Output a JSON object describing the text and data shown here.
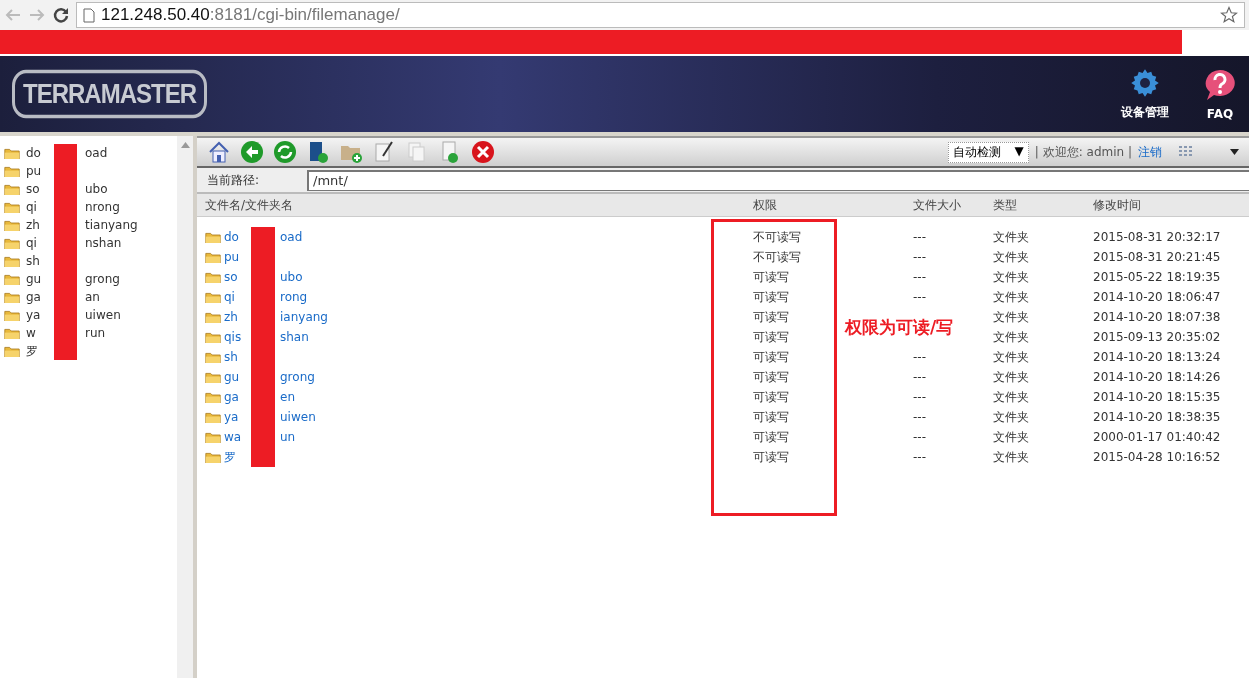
{
  "browser": {
    "url_host": "121.248.50.40",
    "url_path": ":8181/cgi-bin/filemanage/"
  },
  "header": {
    "logo_text": "TERRAMASTER",
    "nav": [
      {
        "kind": "gear",
        "label": "设备管理"
      },
      {
        "kind": "faq",
        "label": "FAQ"
      }
    ]
  },
  "tree": {
    "items": [
      {
        "start": "do",
        "end": "oad"
      },
      {
        "start": "pu"
      },
      {
        "start": "so",
        "end": "ubo"
      },
      {
        "start": "qi",
        "end": "nrong"
      },
      {
        "start": "zh",
        "end": "tianyang"
      },
      {
        "start": "qi",
        "end": "nshan"
      },
      {
        "start": "sh"
      },
      {
        "start": "gu",
        "end": "grong"
      },
      {
        "start": "ga",
        "end": "an"
      },
      {
        "start": "ya",
        "end": "uiwen"
      },
      {
        "start": "w",
        "end": "run"
      },
      {
        "start": "罗"
      }
    ]
  },
  "toolbar": {
    "encoding": "自动检测",
    "encoding_caret": "▼",
    "welcome": "| 欢迎您: admin |",
    "logout": "注销"
  },
  "path": {
    "label": "当前路径:",
    "value": "/mnt/"
  },
  "table": {
    "columns": [
      "文件名/文件夹名",
      "权限",
      "文件大小",
      "类型",
      "修改时间"
    ],
    "rows": [
      {
        "start": "do",
        "end": "oad",
        "permission": "不可读写",
        "size": "---",
        "type": "文件夹",
        "modified": "2015-08-31 20:32:17"
      },
      {
        "start": "pu",
        "permission": "不可读写",
        "size": "---",
        "type": "文件夹",
        "modified": "2015-08-31 20:21:45"
      },
      {
        "start": "so",
        "end": "ubo",
        "permission": "可读写",
        "size": "---",
        "type": "文件夹",
        "modified": "2015-05-22 18:19:35"
      },
      {
        "start": "qi",
        "end": "rong",
        "permission": "可读写",
        "size": "---",
        "type": "文件夹",
        "modified": "2014-10-20 18:06:47"
      },
      {
        "start": "zh",
        "end": "ianyang",
        "permission": "可读写",
        "type": "文件夹",
        "modified": "2014-10-20 18:07:38"
      },
      {
        "start": "qis",
        "end": "shan",
        "permission": "可读写",
        "type": "文件夹",
        "modified": "2015-09-13 20:35:02"
      },
      {
        "start": "sh",
        "permission": "可读写",
        "size": "---",
        "type": "文件夹",
        "modified": "2014-10-20 18:13:24"
      },
      {
        "start": "gu",
        "end": "grong",
        "permission": "可读写",
        "size": "---",
        "type": "文件夹",
        "modified": "2014-10-20 18:14:26"
      },
      {
        "start": "ga",
        "end": "en",
        "permission": "可读写",
        "size": "---",
        "type": "文件夹",
        "modified": "2014-10-20 18:15:35"
      },
      {
        "start": "ya",
        "end": "uiwen",
        "permission": "可读写",
        "size": "---",
        "type": "文件夹",
        "modified": "2014-10-20 18:38:35"
      },
      {
        "start": "wa",
        "end": "un",
        "permission": "可读写",
        "size": "---",
        "type": "文件夹",
        "modified": "2000-01-17 01:40:42"
      },
      {
        "start": "罗",
        "permission": "可读写",
        "size": "---",
        "type": "文件夹",
        "modified": "2015-04-28 10:16:52"
      }
    ]
  },
  "annotation": {
    "text": "权限为可读/写"
  }
}
